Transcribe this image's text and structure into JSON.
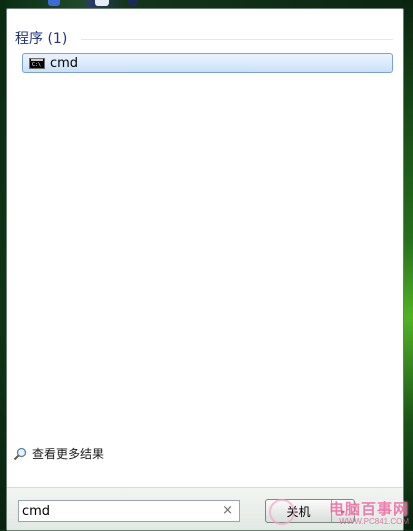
{
  "programs_group": {
    "label": "程序 (1)"
  },
  "results": [
    {
      "icon": "cmd-icon",
      "icon_text": "C:\\",
      "label": "cmd"
    }
  ],
  "see_more": {
    "icon": "magnifier-icon",
    "label": "查看更多结果"
  },
  "search": {
    "value": "cmd",
    "clear_icon": "×"
  },
  "shutdown": {
    "label": "关机",
    "arrow": "▸"
  },
  "watermark": {
    "main": "电脑百事网",
    "sub": "WWW.PC841.COM"
  },
  "colors": {
    "accent": "#1e3287",
    "selection": "#c9e0f9",
    "desktop_green": "#123b1a"
  }
}
